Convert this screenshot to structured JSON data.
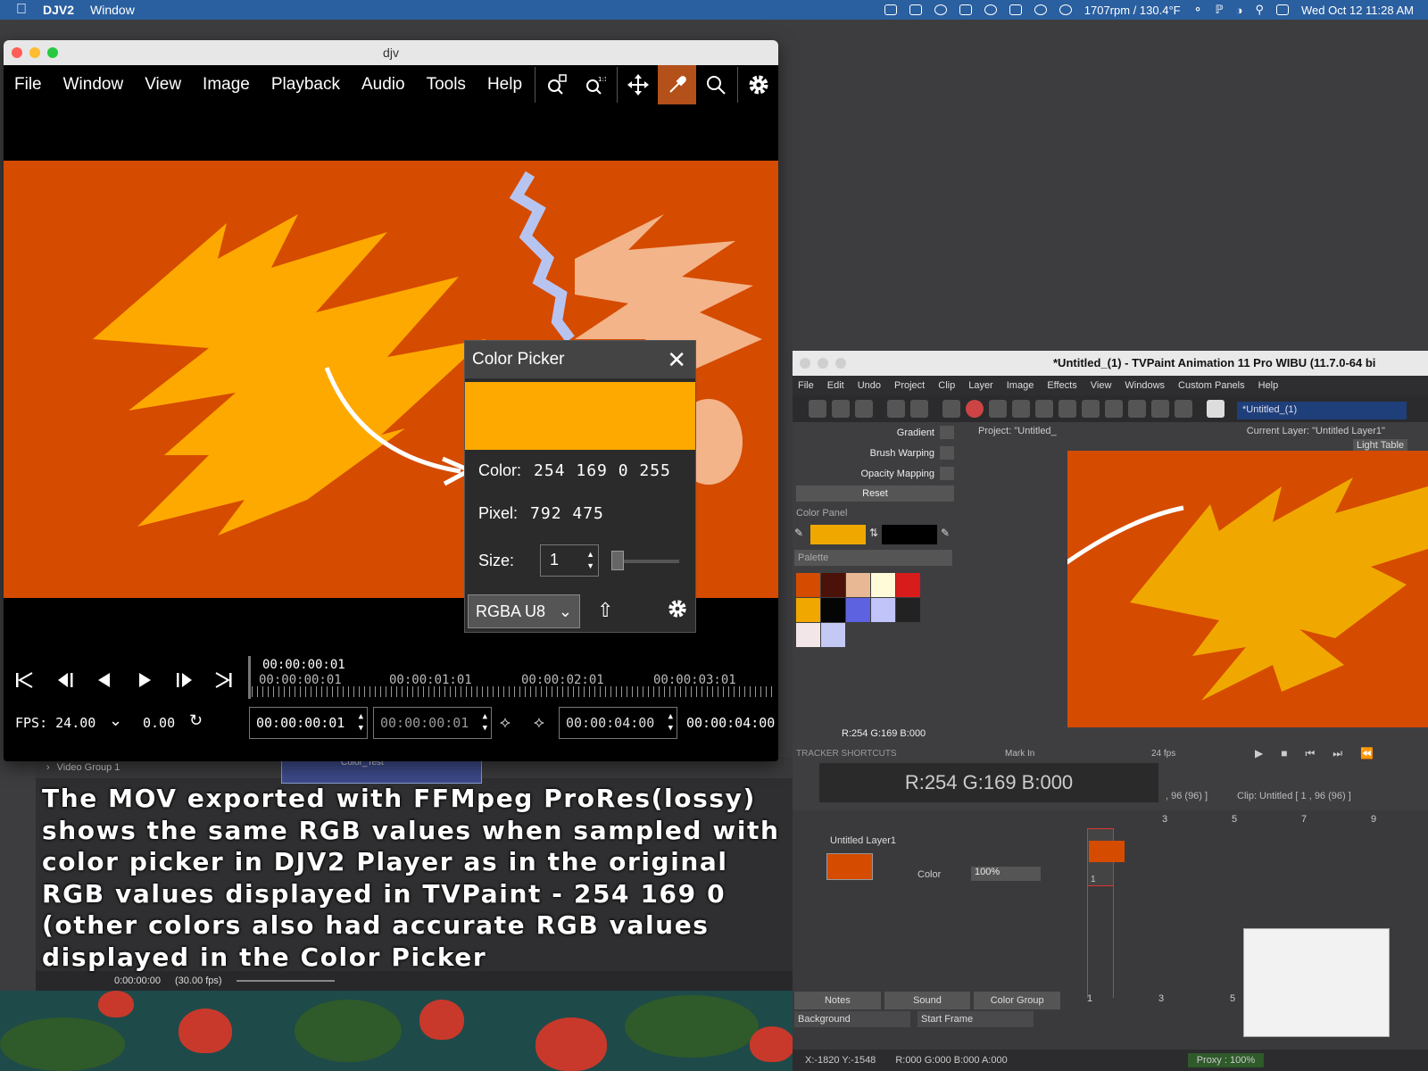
{
  "macos": {
    "app": "DJV2",
    "menu": [
      "Window"
    ],
    "stats": "1707rpm / 130.4°F",
    "datetime": "Wed Oct 12  11:28 AM"
  },
  "djv": {
    "title": "djv",
    "menu": [
      "File",
      "Window",
      "View",
      "Image",
      "Playback",
      "Audio",
      "Tools",
      "Help"
    ],
    "current_time": "00:00:00:01",
    "ruler_labels": [
      "00:00:00:01",
      "00:00:01:01",
      "00:00:02:01",
      "00:00:03:01"
    ],
    "fps_label": "FPS:",
    "fps_value": "24.00",
    "speed": "0.00",
    "in_point": "00:00:00:01",
    "frame": "00:00:00:01",
    "out_point": "00:00:04:00",
    "duration": "00:00:04:00"
  },
  "color_picker": {
    "title": "Color Picker",
    "color_label": "Color:",
    "color_value": "254  169  0  255",
    "pixel_label": "Pixel:",
    "pixel_value": "792  475",
    "size_label": "Size:",
    "size_value": "1",
    "format": "RGBA U8",
    "sample_color": "#fea900"
  },
  "editor": {
    "group": "Video Group 1",
    "clip_name": "Color_Test",
    "timecode": "0:00:00:00",
    "fps": "(30.00 fps)"
  },
  "caption": "The MOV exported with FFMpeg ProRes(lossy) shows the same RGB values when sampled with color picker in DJV2 Player as in the original RGB values displayed in TVPaint -  254 169 0 (other colors also had accurate RGB values displayed in the Color Picker",
  "tvpaint": {
    "title": "*Untitled_(1) - TVPaint Animation 11 Pro WIBU (11.7.0-64 bi",
    "menu": [
      "File",
      "Edit",
      "Undo",
      "Project",
      "Clip",
      "Layer",
      "Image",
      "Effects",
      "View",
      "Windows",
      "Custom Panels",
      "Help"
    ],
    "project_selector": "*Untitled_(1)",
    "side_options": [
      "Gradient",
      "Brush Warping",
      "Opacity Mapping"
    ],
    "reset": "Reset",
    "color_panel": "Color Panel",
    "palette": "Palette",
    "rgb_readout": "R:254 G:169 B:000",
    "big_rgb": "R:254 G:169 B:000",
    "project_info": "Project: \"Untitled_",
    "layer_info": "Current Layer: \"Untitled Layer1\"",
    "light_table": "Light Table",
    "tracker": "TRACKER SHORTCUTS",
    "mark_in": "Mark In",
    "fps": "24 fps",
    "clip_info": "Clip: Untitled [ 1 , 96  (96) ]",
    "frame_range": ", 96  (96) ]",
    "layer_name": "Untitled Layer1",
    "color_label": "Color",
    "opacity": "100%",
    "frame_numbers": [
      "1",
      "3",
      "5",
      "7",
      "9"
    ],
    "tabs": [
      "Notes",
      "Sound",
      "Color Group"
    ],
    "background": "Background",
    "start_frame": "Start Frame",
    "coords": "X:-1820  Y:-1548",
    "rgba": "R:000 G:000 B:000 A:000",
    "proxy": "Proxy : 100%",
    "palette_colors": [
      "#d54b00",
      "#4a1208",
      "#e8b894",
      "#fffbd8",
      "#d81c1c",
      "#f0a800",
      "#050505",
      "#5c62e0",
      "#c0c4f8",
      "#222222",
      "#f2e6e8",
      "#c4c8f4"
    ]
  }
}
